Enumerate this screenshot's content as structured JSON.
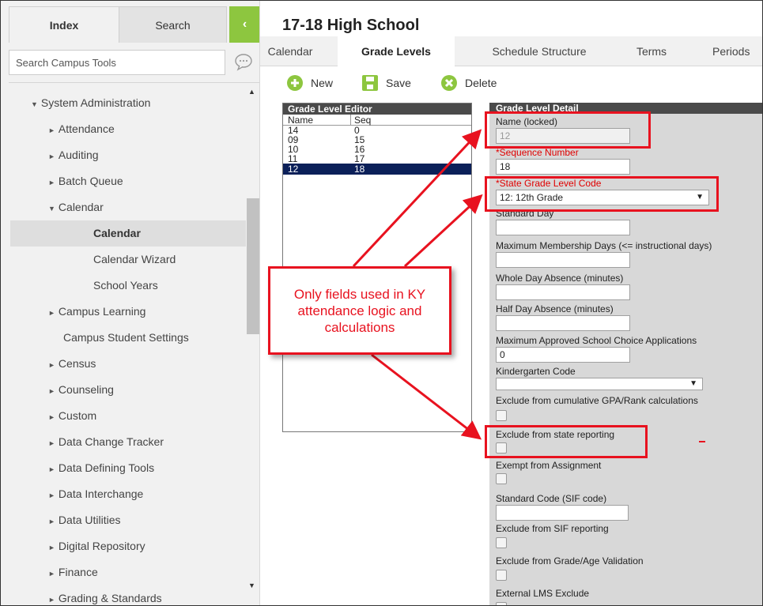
{
  "sidebar": {
    "tabs": {
      "index": "Index",
      "search": "Search",
      "collapse": "‹"
    },
    "search_placeholder": "Search Campus Tools",
    "items": [
      {
        "label": "System Administration",
        "arrow": "▼"
      },
      {
        "label": "Attendance",
        "arrow": "►"
      },
      {
        "label": "Auditing",
        "arrow": "►"
      },
      {
        "label": "Batch Queue",
        "arrow": "►"
      },
      {
        "label": "Calendar",
        "arrow": "▼"
      },
      {
        "label": "Calendar",
        "arrow": ""
      },
      {
        "label": "Calendar Wizard",
        "arrow": ""
      },
      {
        "label": "School Years",
        "arrow": ""
      },
      {
        "label": "Campus Learning",
        "arrow": "►"
      },
      {
        "label": "Campus Student Settings",
        "arrow": ""
      },
      {
        "label": "Census",
        "arrow": "►"
      },
      {
        "label": "Counseling",
        "arrow": "►"
      },
      {
        "label": "Custom",
        "arrow": "►"
      },
      {
        "label": "Data Change Tracker",
        "arrow": "►"
      },
      {
        "label": "Data Defining Tools",
        "arrow": "►"
      },
      {
        "label": "Data Interchange",
        "arrow": "►"
      },
      {
        "label": "Data Utilities",
        "arrow": "►"
      },
      {
        "label": "Digital Repository",
        "arrow": "►"
      },
      {
        "label": "Finance",
        "arrow": "►"
      },
      {
        "label": "Grading & Standards",
        "arrow": "►"
      }
    ]
  },
  "main": {
    "title": "17-18 High School",
    "tabs": [
      "Calendar",
      "Grade Levels",
      "Schedule Structure",
      "Terms",
      "Periods"
    ],
    "toolbar": {
      "new": "New",
      "save": "Save",
      "delete": "Delete"
    },
    "editor": {
      "title": "Grade Level Editor",
      "columns": [
        "Name",
        "Seq"
      ],
      "rows": [
        {
          "name": "14",
          "seq": "0"
        },
        {
          "name": "09",
          "seq": "15"
        },
        {
          "name": "10",
          "seq": "16"
        },
        {
          "name": "11",
          "seq": "17"
        },
        {
          "name": "12",
          "seq": "18"
        }
      ]
    },
    "detail": {
      "title": "Grade Level Detail",
      "name_label": "Name (locked)",
      "name_value": "12",
      "sequence_label": "*Sequence Number",
      "sequence_value": "18",
      "state_code_label": "*State Grade Level Code",
      "state_code_value": "12: 12th Grade",
      "standard_day_label": "Standard Day",
      "max_membership_label": "Maximum Membership Days (<= instructional days)",
      "whole_day_label": "Whole Day Absence (minutes)",
      "half_day_label": "Half Day Absence (minutes)",
      "max_school_choice_label": "Maximum Approved School Choice Applications",
      "max_school_choice_value": "0",
      "kindergarten_label": "Kindergarten Code",
      "exclude_gpa_label": "Exclude from cumulative GPA/Rank calculations",
      "exclude_state_label": "Exclude from state reporting",
      "exempt_assignment_label": "Exempt from Assignment",
      "standard_code_label": "Standard Code (SIF code)",
      "exclude_sif_label": "Exclude from SIF reporting",
      "exclude_age_label": "Exclude from Grade/Age Validation",
      "external_lms_label": "External LMS Exclude"
    }
  },
  "annotation": {
    "callout_text": "Only fields used in KY attendance logic and calculations",
    "color": "#e8121f"
  },
  "colors": {
    "accent_green": "#8dc63f",
    "selected_row": "#0b2059",
    "header_dark": "#4a4a4a"
  }
}
